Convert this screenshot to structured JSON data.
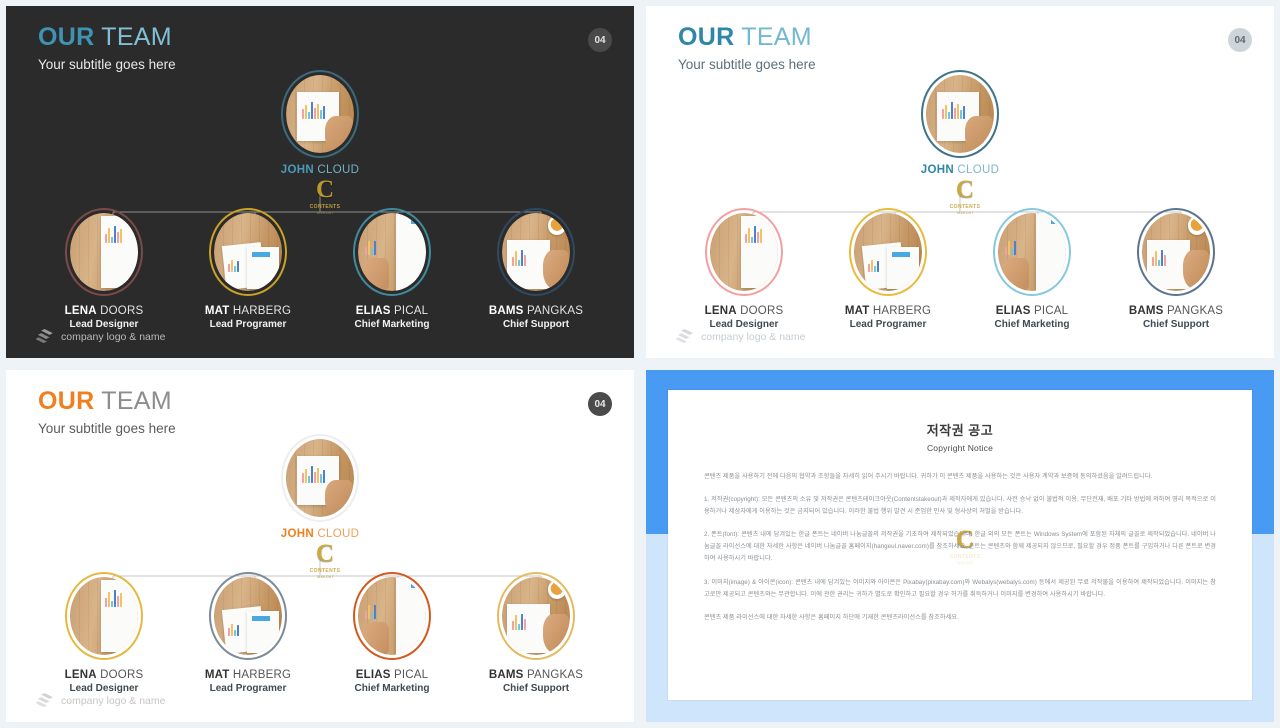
{
  "slides": [
    {
      "id": "panel-dark-teal",
      "theme": "dark",
      "title_strong": "OUR",
      "title_light": " TEAM",
      "subtitle": "Your subtitle goes here",
      "page_number": "04",
      "ceo": {
        "first": "JOHN",
        "last": " CLOUD",
        "ring_color": "#3a6a7d"
      },
      "members": [
        {
          "first": "LENA",
          "last": " DOORS",
          "role": "Lead Designer",
          "ring_color": "#7b4a4a"
        },
        {
          "first": "MAT",
          "last": " HARBERG",
          "role": "Lead Programer",
          "ring_color": "#c9a227"
        },
        {
          "first": "ELIAS",
          "last": " PICAL",
          "role": "Chief Marketing",
          "ring_color": "#3f8c9e"
        },
        {
          "first": "BAMS",
          "last": " PANGKAS",
          "role": "Chief Support",
          "ring_color": "#2e4a63"
        }
      ],
      "footer": "company logo & name",
      "footer_icon": "layers-logo-icon",
      "connector_color": "#8d8d8d"
    },
    {
      "id": "panel-light-blue",
      "theme": "light",
      "title_strong": "OUR",
      "title_light": " TEAM",
      "subtitle": "Your subtitle goes here",
      "page_number": "04",
      "ceo": {
        "first": "JOHN",
        "last": " CLOUD",
        "ring_color": "#3c7488"
      },
      "members": [
        {
          "first": "LENA",
          "last": " DOORS",
          "role": "Lead Designer",
          "ring_color": "#f4a0a0"
        },
        {
          "first": "MAT",
          "last": " HARBERG",
          "role": "Lead Programer",
          "ring_color": "#e8bb3c"
        },
        {
          "first": "ELIAS",
          "last": " PICAL",
          "role": "Chief Marketing",
          "ring_color": "#86c8dd"
        },
        {
          "first": "BAMS",
          "last": " PANGKAS",
          "role": "Chief Support",
          "ring_color": "#5a7490"
        }
      ],
      "footer": "company logo & name",
      "footer_icon": "layers-logo-icon",
      "connector_color": "#c7c7c7"
    },
    {
      "id": "panel-light-orange",
      "theme": "light",
      "title_strong": "OUR",
      "title_light": " TEAM",
      "subtitle": "Your subtitle goes here",
      "page_number": "04",
      "ceo": {
        "first": "JOHN",
        "last": " CLOUD",
        "ring_color": "#eeeeee"
      },
      "members": [
        {
          "first": "LENA",
          "last": " DOORS",
          "role": "Lead Designer",
          "ring_color": "#e5b93f"
        },
        {
          "first": "MAT",
          "last": " HARBERG",
          "role": "Lead Programer",
          "ring_color": "#7b8b99"
        },
        {
          "first": "ELIAS",
          "last": " PICAL",
          "role": "Chief Marketing",
          "ring_color": "#d2591e"
        },
        {
          "first": "BAMS",
          "last": " PANGKAS",
          "role": "Chief Support",
          "ring_color": "#e3bb60"
        }
      ],
      "footer": "company logo & name",
      "footer_icon": "layers-logo-icon",
      "connector_color": "#c7c7c7"
    }
  ],
  "watermark": {
    "letter": "C",
    "line1": "CONTENTS",
    "line2": "TAKEOUT"
  },
  "copyright_panel": {
    "title_ko": "저작권 공고",
    "title_en": "Copyright Notice",
    "paragraphs": [
      "콘텐츠 제품을 사용하기 전에 다음의 협약과 조항들을 자세히 읽어 주시기 바랍니다. 귀하가 이 콘텐츠 제품을 사용하는 것은 사용자 계약과 보증에 동의하셨음을 알려드립니다.",
      "1. 저작권(copyright): 모든 콘텐츠의 소유 및 저작권은 콘텐츠테이크아웃(Contentstakeout)과 제작자에게 있습니다. 사전 승낙 없이 불법적 이용, 무단전재, 배포 기타 방법에 의하여 영리 목적으로 이용하거나 제삼자에게 이용하는 것은 금지되어 있습니다. 이러한 불법 행위 발견 시 준엄한 민사 및 형사상의 처벌을 받습니다.",
      "2. 폰트(font): 콘텐츠 내에 담겨있는 한글 폰트는 네이버 나눔글꼴의 저작권을 기초하여 제작되었습니다. 한글 외의 모든 폰트는 Windows System에 포함된 자체의 글꼴로 제작되었습니다. 네이버 나눔글꼴 라이선스에 대한 자세한 사항은 네이버 나눔글꼴 홈페이지(hangeul.naver.com)를 참조하세요. 폰트는 콘텐츠와 함께 제공되지 않으므로, 필요할 경우 정품 폰트를 구입하거나 다른 폰트로 변경하여 사용하시기 바랍니다.",
      "3. 이미지(image) & 아이콘(icon): 콘텐츠 내에 담겨있는 이미지와 아이콘은 Pixabay(pixabay.com)와 Webalys(webalys.com) 등에서 제공된 무료 저작물을 이용하여 제작되었습니다. 이미지는 참고로만 제공되고 콘텐츠와는 무관합니다. 이에 관한 권리는 귀하가 별도로 확인하고 필요할 경우 허가를 취득하거나 이미지를 변경하여 사용하시기 바랍니다.",
      "콘텐츠 제품 라이선스에 대한 자세한 사항은 홈페이지 하단에 기재한 콘텐츠라이선스를 참조하세요."
    ]
  }
}
